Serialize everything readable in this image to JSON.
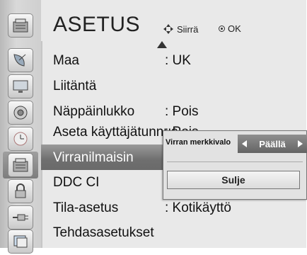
{
  "header": {
    "title": "ASETUS",
    "hint_move": "Siirrä",
    "hint_ok": "OK"
  },
  "icons": [
    {
      "name": "setup-icon",
      "selected": false
    },
    {
      "name": "satellite-dish-icon",
      "selected": false
    },
    {
      "name": "monitor-icon",
      "selected": false
    },
    {
      "name": "speaker-icon",
      "selected": false
    },
    {
      "name": "clock-icon",
      "selected": false
    },
    {
      "name": "setup-icon",
      "selected": true
    },
    {
      "name": "lock-icon",
      "selected": false
    },
    {
      "name": "input-plug-icon",
      "selected": false
    },
    {
      "name": "photo-icon",
      "selected": false
    }
  ],
  "menu": {
    "items": [
      {
        "label": "Maa",
        "value": ": UK"
      },
      {
        "label": "Liitäntä",
        "value": ""
      },
      {
        "label": "Näppäinlukko",
        "value": ": Pois"
      },
      {
        "label": "Aseta käyttäjätunnus",
        "value": ": Pois"
      },
      {
        "label": "Virranilmaisin",
        "value": ""
      },
      {
        "label": "DDC CI",
        "value": ""
      },
      {
        "label": "Tila-asetus",
        "value": ": Kotikäyttö"
      },
      {
        "label": "Tehdasasetukset",
        "value": ""
      }
    ],
    "selected_index": 4
  },
  "popup": {
    "label": "Virran merkkivalo",
    "value": "Päällä",
    "close_label": "Sulje"
  }
}
